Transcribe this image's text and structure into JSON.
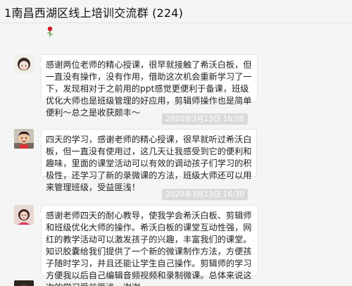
{
  "chat": {
    "title": "1南昌西湖区线上培训交流群 (224)"
  },
  "messages": [
    {
      "avatar": "girl-avatar",
      "text": "感谢两位老师的精心授课，很早就接触了希沃白板，但一直没有操作，没有作用，借助这次机会重新学习了一下，发现相对于之前用的ppt感觉更便利于备课，班级优化大师也是班级管理的好应用，剪辑师操作也是简单便利～总之是收获颇丰～"
    },
    {
      "timestamp": "2020年3月13日 16:08",
      "avatar": "child-avatar",
      "text": "四天的学习，感谢老师的精心授课，很早就听过希沃白板，但一直没有使用过，这几天让我感受到它的便利和趣味，里面的课堂活动可以有效的调动孩子们学习的积极性，还学习了新的录微课的方法，班级大师还可以用来管理班级，受益匪浅！"
    },
    {
      "timestamp": "2020年3月13日 16:30",
      "avatar": "woman-avatar",
      "text": "感谢老师四天的耐心教导，使我学会希沃白板、剪辑师和班级优化大师的操作。希沃白板的课堂互动性强，网红的教学活动可以激发孩子的兴趣，丰富我们的课堂。知识胶囊给我们提供了一个新的微课制作方法，方便孩子随时学习，并且还能让学生自己操作。剪辑师的学习方便我以后自己编辑音频视频和录制微课。总体来说这次的学习受益匪浅。谢谢。"
    }
  ],
  "colors": {
    "window_bg": "#f5f5f5",
    "bubble_bg": "#ffffff",
    "timestamp_bg": "#dadada"
  }
}
